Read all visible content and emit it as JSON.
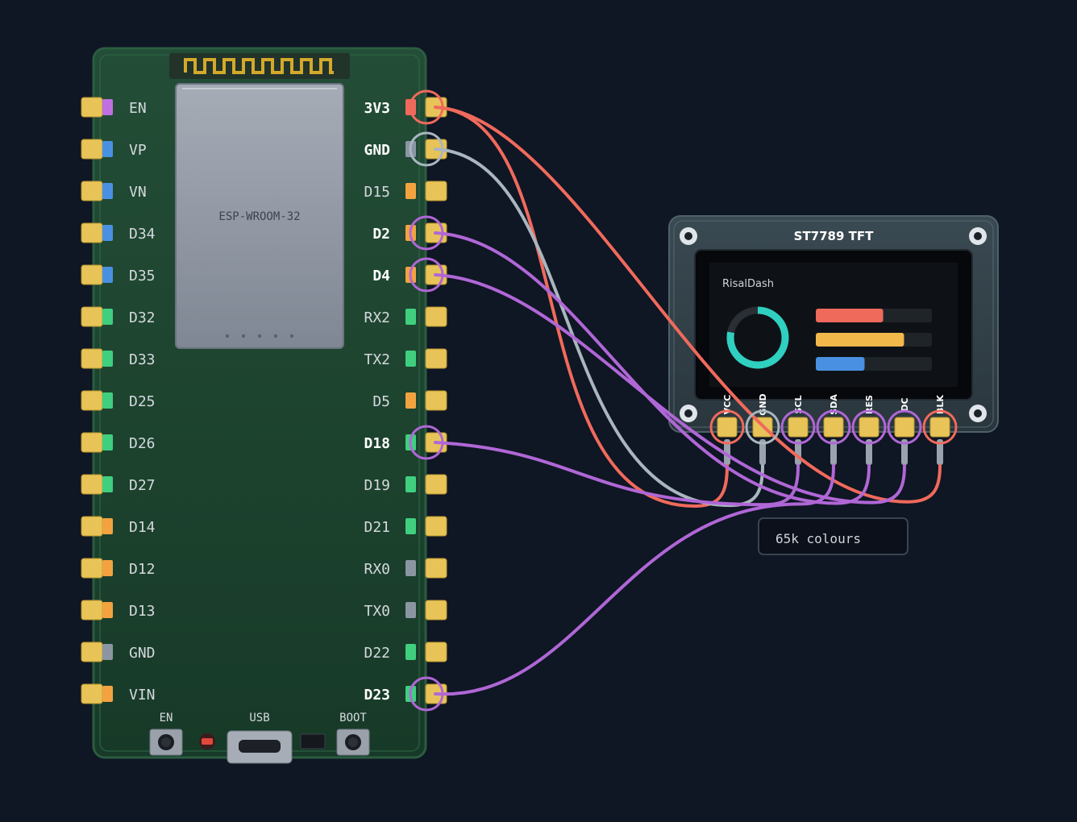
{
  "colors": {
    "background": "#0f1624",
    "board": "#1f4a32",
    "pad": "#e8c458",
    "wire_power": "#f06a5c",
    "wire_ground": "#a9b6bf",
    "wire_signal": "#b067d6",
    "pin_purple": "#c070e0",
    "pin_blue": "#4a90e2",
    "pin_green": "#3fcf7f",
    "pin_orange": "#f2a340",
    "pin_gray": "#8b96a3",
    "pin_red": "#f06a5c"
  },
  "board": {
    "module_label": "ESP-WROOM-32",
    "left_pins": [
      {
        "label": "EN",
        "indicator": "purple"
      },
      {
        "label": "VP",
        "indicator": "blue"
      },
      {
        "label": "VN",
        "indicator": "blue"
      },
      {
        "label": "D34",
        "indicator": "blue"
      },
      {
        "label": "D35",
        "indicator": "blue"
      },
      {
        "label": "D32",
        "indicator": "green"
      },
      {
        "label": "D33",
        "indicator": "green"
      },
      {
        "label": "D25",
        "indicator": "green"
      },
      {
        "label": "D26",
        "indicator": "green"
      },
      {
        "label": "D27",
        "indicator": "green"
      },
      {
        "label": "D14",
        "indicator": "orange"
      },
      {
        "label": "D12",
        "indicator": "orange"
      },
      {
        "label": "D13",
        "indicator": "orange"
      },
      {
        "label": "GND",
        "indicator": "gray"
      },
      {
        "label": "VIN",
        "indicator": "orange"
      }
    ],
    "right_pins": [
      {
        "label": "3V3",
        "indicator": "red",
        "connected": true
      },
      {
        "label": "GND",
        "indicator": "gray",
        "connected": true
      },
      {
        "label": "D15",
        "indicator": "orange",
        "connected": false
      },
      {
        "label": "D2",
        "indicator": "orange",
        "connected": true
      },
      {
        "label": "D4",
        "indicator": "orange",
        "connected": true
      },
      {
        "label": "RX2",
        "indicator": "green",
        "connected": false
      },
      {
        "label": "TX2",
        "indicator": "green",
        "connected": false
      },
      {
        "label": "D5",
        "indicator": "orange",
        "connected": false
      },
      {
        "label": "D18",
        "indicator": "green",
        "connected": true
      },
      {
        "label": "D19",
        "indicator": "green",
        "connected": false
      },
      {
        "label": "D21",
        "indicator": "green",
        "connected": false
      },
      {
        "label": "RX0",
        "indicator": "gray",
        "connected": false
      },
      {
        "label": "TX0",
        "indicator": "gray",
        "connected": false
      },
      {
        "label": "D22",
        "indicator": "green",
        "connected": false
      },
      {
        "label": "D23",
        "indicator": "green",
        "connected": true
      }
    ],
    "buttons": {
      "en_label": "EN",
      "usb_label": "USB",
      "boot_label": "BOOT"
    }
  },
  "display": {
    "title": "ST7789 TFT",
    "screen_title": "RisalDash",
    "gauge_fraction": 0.78,
    "bars": [
      {
        "fraction": 0.58,
        "color": "#f06a5c"
      },
      {
        "fraction": 0.76,
        "color": "#f2b84a"
      },
      {
        "fraction": 0.42,
        "color": "#4a90e2"
      }
    ],
    "pins": [
      {
        "label": "VCC",
        "ring": "red"
      },
      {
        "label": "GND",
        "ring": "gray"
      },
      {
        "label": "SCL",
        "ring": "purple"
      },
      {
        "label": "SDA",
        "ring": "purple"
      },
      {
        "label": "RES",
        "ring": "purple"
      },
      {
        "label": "DC",
        "ring": "purple"
      },
      {
        "label": "BLK",
        "ring": "red"
      }
    ],
    "badge": "65k colours"
  },
  "connections": [
    {
      "from": "3V3",
      "to": "VCC",
      "kind": "power"
    },
    {
      "from": "3V3",
      "to": "BLK",
      "kind": "power"
    },
    {
      "from": "GND",
      "to": "GND",
      "kind": "ground"
    },
    {
      "from": "D2",
      "to": "RES",
      "kind": "signal"
    },
    {
      "from": "D4",
      "to": "DC",
      "kind": "signal"
    },
    {
      "from": "D18",
      "to": "SCL",
      "kind": "signal"
    },
    {
      "from": "D23",
      "to": "SDA",
      "kind": "signal"
    }
  ]
}
